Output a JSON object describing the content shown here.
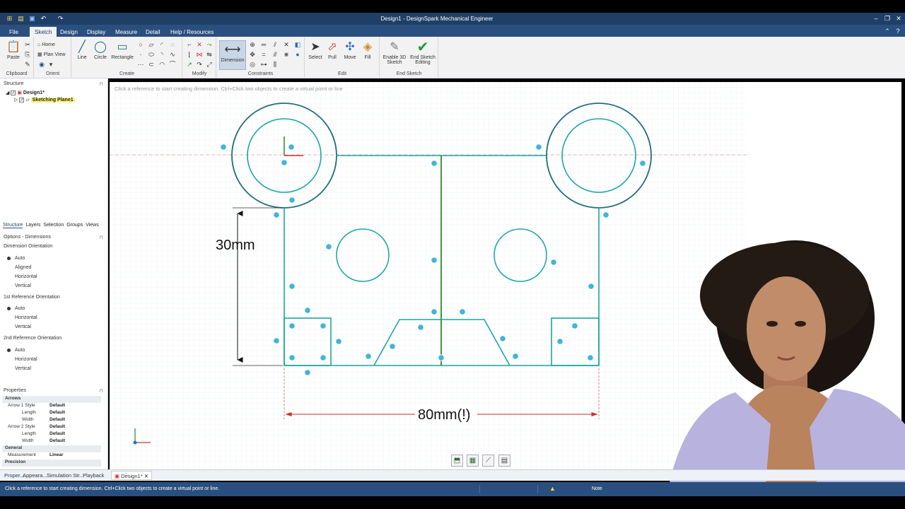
{
  "app": {
    "title": "Design1 - DesignSpark Mechanical Engineer"
  },
  "menu": {
    "tabs": [
      "File",
      "Sketch",
      "Design",
      "Display",
      "Measure",
      "Detail",
      "Help / Resources"
    ],
    "active": "Sketch"
  },
  "ribbon": {
    "clipboard": {
      "paste": "Paste",
      "label": "Clipboard"
    },
    "orient": {
      "home": "Home",
      "plan_view": "Plan View",
      "label": "Orient"
    },
    "create": {
      "line": "Line",
      "circle": "Circle",
      "rectangle": "Rectangle",
      "label": "Create"
    },
    "modify": {
      "label": "Modify"
    },
    "constraints": {
      "dimension": "Dimension",
      "label": "Constraints"
    },
    "edit": {
      "select": "Select",
      "pull": "Pull",
      "move": "Move",
      "fill": "Fill",
      "label": "Edit"
    },
    "end_sketch": {
      "enable_3d": "Enable 3D Sketch",
      "end_sketch_editing": "End Sketch Editing",
      "label": "End Sketch"
    }
  },
  "structure": {
    "title": "Structure",
    "pin": "⊓",
    "root": "Design1*",
    "child": "Sketching Plane1"
  },
  "panel_tabs": [
    "Structure",
    "Layers",
    "Selection",
    "Groups",
    "Views"
  ],
  "options": {
    "title": "Options - Dimensions",
    "pin": "⊓",
    "dimension_orientation": {
      "label": "Dimension Orientation",
      "items": [
        "Auto",
        "Aligned",
        "Horizontal",
        "Vertical"
      ],
      "selected": "Auto"
    },
    "first_ref": {
      "label": "1st Reference Orientation",
      "items": [
        "Auto",
        "Horizontal",
        "Vertical"
      ],
      "selected": "Auto"
    },
    "second_ref": {
      "label": "2nd Reference Orientation",
      "items": [
        "Auto",
        "Horizontal",
        "Vertical"
      ],
      "selected": "Auto"
    }
  },
  "properties": {
    "title": "Properties",
    "pin": "⊓",
    "rows": [
      {
        "k": "Arrows",
        "v": "",
        "section": true
      },
      {
        "k": "Arrow 1 Style",
        "v": "Default"
      },
      {
        "k": "Length",
        "v": "Default"
      },
      {
        "k": "Width",
        "v": "Default"
      },
      {
        "k": "Arrow 2 Style",
        "v": "Default"
      },
      {
        "k": "Length",
        "v": "Default"
      },
      {
        "k": "Width",
        "v": "Default"
      },
      {
        "k": "General",
        "v": "",
        "section": true
      },
      {
        "k": "Measurement",
        "v": "Linear"
      },
      {
        "k": "Precision",
        "v": "",
        "section": true
      }
    ]
  },
  "canvas": {
    "hint": "Click a reference to start creating dimension. Ctrl+Click two objects to create a virtual point or line",
    "dim_vertical": "30mm",
    "dim_horizontal": "80mm(!)",
    "colors": {
      "sketch": "#1aa8a0",
      "outer_circle": "#1f6f7a",
      "grid": "#e6ecef",
      "dim_arrow": "#d22a2a",
      "center_line": "#2a8a2a"
    }
  },
  "bottom_tabs": [
    "Proper...",
    "Appeara...",
    "Simulation Str...",
    "Playback"
  ],
  "doc_tab": "Design1*",
  "status": {
    "message": "Click a reference to start creating dimension. Ctrl+Click two objects to create a virtual point or line.",
    "note": "Note"
  }
}
